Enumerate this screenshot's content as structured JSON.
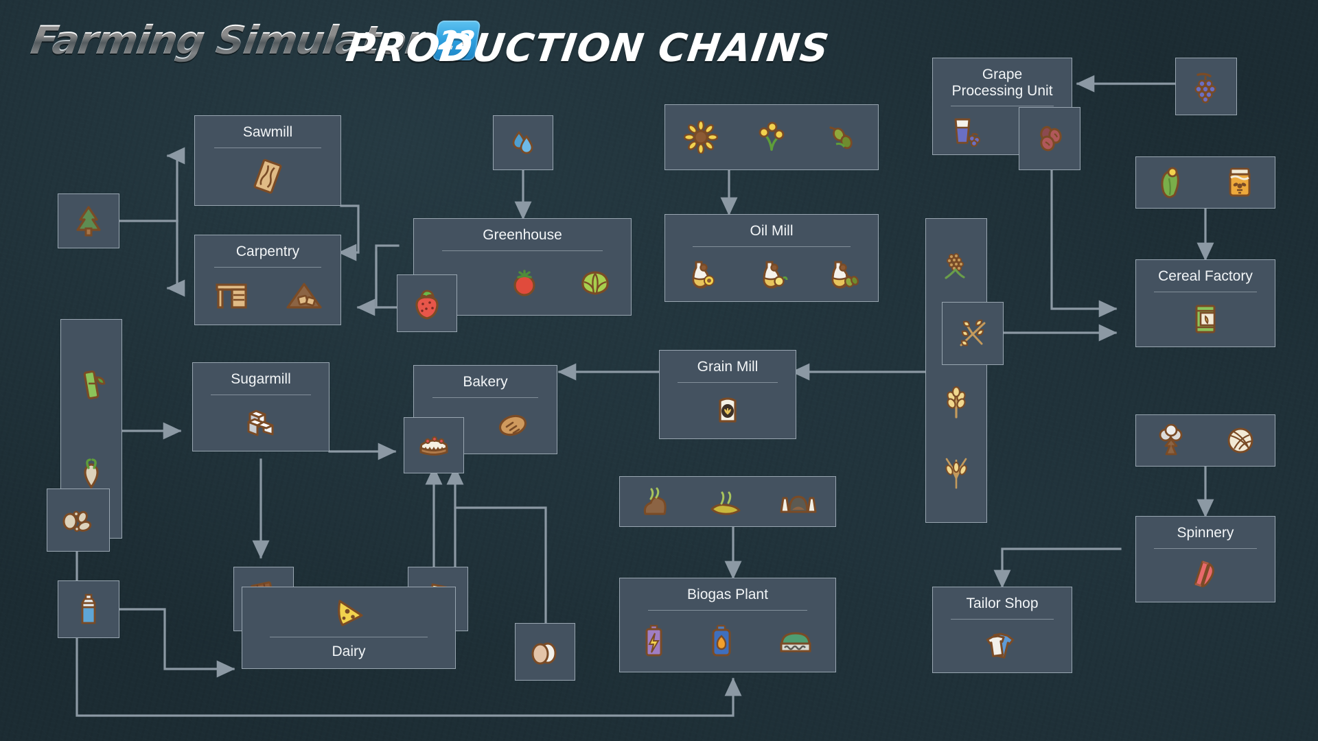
{
  "header": {
    "logo_text": "Farming Simulator",
    "logo_badge": "22",
    "title": "PRODUCTION CHAINS"
  },
  "colors": {
    "background": "#1c2c33",
    "node_fill": "#445260",
    "node_border": "#9aa7b2",
    "wire": "#8c99a4",
    "title_text": "#f2f5f7",
    "badge_blue": "#2b9ede"
  },
  "nodes": [
    {
      "id": "tree",
      "label": "",
      "icons": [
        "tree-icon"
      ]
    },
    {
      "id": "sawmill",
      "label": "Sawmill",
      "icons": [
        "planks-icon"
      ]
    },
    {
      "id": "carpentry",
      "label": "Carpentry",
      "icons": [
        "furniture-icon",
        "woodchips-icon"
      ]
    },
    {
      "id": "sugar-inputs",
      "label": "",
      "icons": [
        "sugarcane-icon",
        "sugarbeet-icon"
      ]
    },
    {
      "id": "sugarbeet-cut",
      "label": "",
      "icons": [
        "sugarbeet-cut-icon"
      ]
    },
    {
      "id": "sugarmill",
      "label": "Sugarmill",
      "icons": [
        "sugar-cubes-icon"
      ]
    },
    {
      "id": "milk",
      "label": "",
      "icons": [
        "milk-canister-icon"
      ]
    },
    {
      "id": "chocolate",
      "label": "",
      "icons": [
        "chocolate-icon"
      ]
    },
    {
      "id": "butter",
      "label": "",
      "icons": [
        "butter-icon"
      ]
    },
    {
      "id": "dairy",
      "label": "Dairy",
      "icons": [
        "cheese-icon"
      ]
    },
    {
      "id": "water",
      "label": "",
      "icons": [
        "water-drops-icon"
      ]
    },
    {
      "id": "greenhouse",
      "label": "Greenhouse",
      "icons": [
        "tomato-icon",
        "lettuce-icon"
      ]
    },
    {
      "id": "strawberry",
      "label": "",
      "icons": [
        "strawberry-icon"
      ]
    },
    {
      "id": "bakery",
      "label": "Bakery",
      "icons": [
        "bread-icon"
      ]
    },
    {
      "id": "cake",
      "label": "",
      "icons": [
        "cake-icon"
      ]
    },
    {
      "id": "eggs",
      "label": "",
      "icons": [
        "eggs-icon"
      ]
    },
    {
      "id": "grain-mill",
      "label": "Grain Mill",
      "icons": [
        "flour-bag-icon"
      ]
    },
    {
      "id": "oil-crops",
      "label": "",
      "icons": [
        "sunflower-icon",
        "canola-icon",
        "olive-icon"
      ]
    },
    {
      "id": "oil-mill",
      "label": "Oil Mill",
      "icons": [
        "sunflower-oil-icon",
        "canola-oil-icon",
        "olive-oil-icon"
      ]
    },
    {
      "id": "biogas-inputs",
      "label": "",
      "icons": [
        "manure-icon",
        "slurry-icon",
        "silage-icon"
      ]
    },
    {
      "id": "biogas-plant",
      "label": "Biogas Plant",
      "icons": [
        "electricity-icon",
        "methane-icon",
        "digestate-icon"
      ]
    },
    {
      "id": "grapes",
      "label": "",
      "icons": [
        "grapes-icon"
      ]
    },
    {
      "id": "grape-processing",
      "label": "Grape\nProcessing Unit",
      "icons": [
        "grape-juice-icon"
      ]
    },
    {
      "id": "raisins",
      "label": "",
      "icons": [
        "raisins-icon"
      ]
    },
    {
      "id": "cereal-crops",
      "label": "",
      "icons": [
        "sorghum-icon",
        "oat-icon",
        "wheat-icon",
        "barley-icon"
      ]
    },
    {
      "id": "oat-highlight",
      "label": "",
      "icons": [
        "oat-icon"
      ]
    },
    {
      "id": "cereal-inputs",
      "label": "",
      "icons": [
        "corn-icon",
        "honey-jar-icon"
      ]
    },
    {
      "id": "cereal-factory",
      "label": "Cereal Factory",
      "icons": [
        "cereal-box-icon"
      ]
    },
    {
      "id": "wool-inputs",
      "label": "",
      "icons": [
        "cotton-icon",
        "wool-icon"
      ]
    },
    {
      "id": "spinnery",
      "label": "Spinnery",
      "icons": [
        "fabric-icon"
      ]
    },
    {
      "id": "tailor-shop",
      "label": "Tailor Shop",
      "icons": [
        "clothes-icon"
      ]
    }
  ],
  "labels": {
    "sawmill": "Sawmill",
    "carpentry": "Carpentry",
    "sugarmill": "Sugarmill",
    "dairy": "Dairy",
    "greenhouse": "Greenhouse",
    "bakery": "Bakery",
    "grain_mill": "Grain Mill",
    "oil_mill": "Oil Mill",
    "biogas_plant": "Biogas Plant",
    "grape_processing": "Grape\nProcessing Unit",
    "cereal_factory": "Cereal Factory",
    "spinnery": "Spinnery",
    "tailor_shop": "Tailor Shop"
  }
}
